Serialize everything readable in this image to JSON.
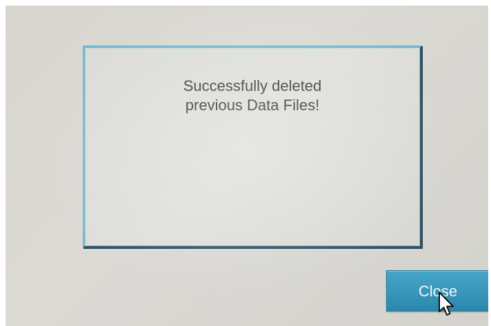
{
  "dialog": {
    "message": "Successfully deleted\nprevious Data Files!"
  },
  "buttons": {
    "close_label": "Close"
  },
  "colors": {
    "accent": "#3796bb",
    "dialog_border": "#6bb8d0",
    "background": "#d9d6d0"
  },
  "icons": {
    "cursor": "mouse-pointer-icon"
  }
}
